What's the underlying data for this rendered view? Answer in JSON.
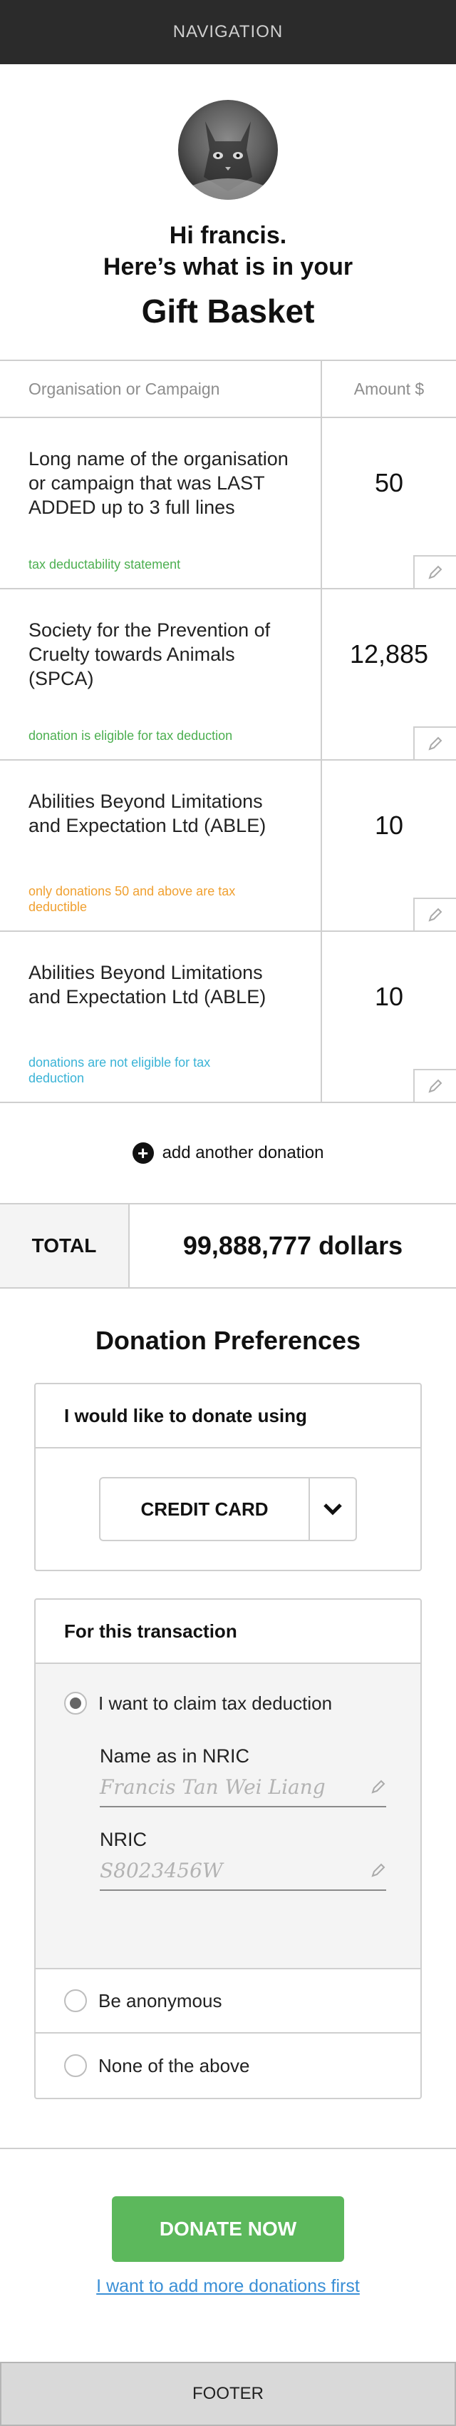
{
  "nav": {
    "label": "NAVIGATION"
  },
  "hero": {
    "greeting": "Hi francis.",
    "line2": "Here’s what is in your",
    "title": "Gift Basket"
  },
  "table": {
    "col_org": "Organisation or Campaign",
    "col_amount": "Amount $",
    "rows": [
      {
        "name": "Long name of the organisation or campaign that was LAST ADDED up to 3 full lines",
        "note": "tax deductability statement",
        "note_color": "#4caf50",
        "amount": "50"
      },
      {
        "name": "Society for the Prevention of Cruelty towards Animals (SPCA)",
        "note": "donation is eligible for tax deduction",
        "note_color": "#4caf50",
        "amount": "12,885"
      },
      {
        "name": "Abilities Beyond Limitations and Expectation Ltd (ABLE)",
        "note": "only donations 50 and above are tax deductible",
        "note_color": "#f0a030",
        "amount": "10"
      },
      {
        "name": "Abilities Beyond Limitations and Expectation Ltd (ABLE)",
        "note": "donations are not eligible for tax deduction",
        "note_color": "#3ab3d6",
        "amount": "10"
      }
    ]
  },
  "add": {
    "label": "add another donation"
  },
  "total": {
    "label": "TOTAL",
    "value": "99,888,777 dollars"
  },
  "prefs": {
    "title": "Donation Preferences",
    "pay_heading": "I would like to donate using",
    "pay_method": "CREDIT CARD",
    "txn_heading": "For this transaction",
    "opt_claim": "I want to claim tax deduction",
    "name_label": "Name as in NRIC",
    "name_value": "Francis Tan Wei Liang",
    "nric_label": "NRIC",
    "nric_value": "S8023456W",
    "opt_anon": "Be anonymous",
    "opt_none": "None of the above"
  },
  "actions": {
    "donate": "DONATE NOW",
    "more": "I want to add more donations first"
  },
  "footer": {
    "label": "FOOTER"
  },
  "colors": {
    "accent_green": "#5cb85c",
    "link_blue": "#3a8fd6",
    "nav_bg": "#2b2b2b"
  },
  "icons": [
    "avatar-cat-photo",
    "pencil-icon",
    "plus-circle-icon",
    "chevron-down-icon"
  ]
}
